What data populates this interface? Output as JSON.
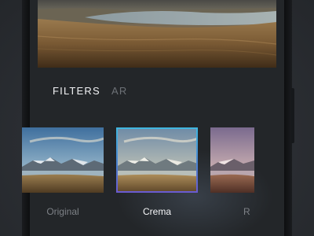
{
  "tabs": {
    "filters_label": "FILTERS",
    "ar_label": "AR"
  },
  "filters": [
    {
      "label": "Original"
    },
    {
      "label": "Crema"
    },
    {
      "label": "R"
    }
  ],
  "colors": {
    "selection_border_top": "#3fb6e0",
    "selection_border_bottom": "#6a5bd0",
    "active_text": "#f2f3f5",
    "inactive_text": "#6d7176"
  }
}
